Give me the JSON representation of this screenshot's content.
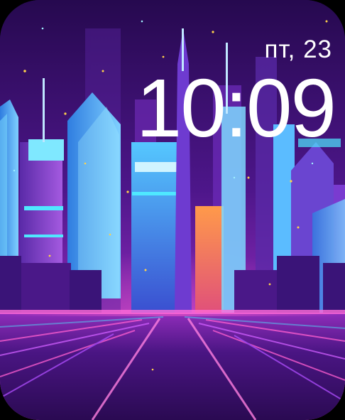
{
  "watch": {
    "date": "пт, 23",
    "time": "10:09"
  },
  "wallpaper": {
    "theme": "neon-cyberpunk-city",
    "colors": {
      "sky_top": "#2a0c5e",
      "sky_mid": "#6a1fa8",
      "horizon_glow": "#ff3fa8",
      "road": "#3a0f6a",
      "neon_cyan": "#4fe8ff",
      "neon_pink": "#ff4fd8",
      "building_blue": "#3aa8ff",
      "building_purple": "#7a3bd0"
    }
  }
}
